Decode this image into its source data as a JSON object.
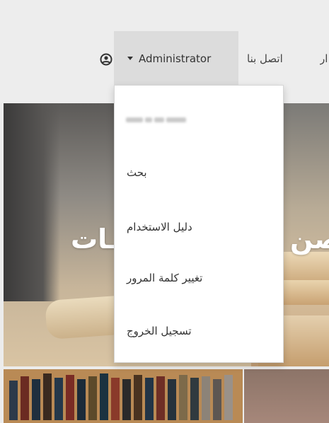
{
  "nav": {
    "cut_link": "ار",
    "contact": "اتصل بنا",
    "user_menu": "Administrator",
    "user_icon": "user-circle-icon"
  },
  "dropdown": {
    "items": [
      {
        "label": "",
        "note": "blurred"
      },
      {
        "label": "بحث"
      },
      {
        "label": "دليل الاستخدام"
      },
      {
        "label": "تغيير كلمة المرور"
      },
      {
        "label": "تسجيل الخروج"
      }
    ]
  },
  "hero": {
    "text_left": "ـات",
    "text_right": "صن"
  },
  "colors": {
    "navbar_bg": "#ededed",
    "active_menu_bg": "#dcdcdc",
    "dropdown_bg": "#ffffff"
  }
}
